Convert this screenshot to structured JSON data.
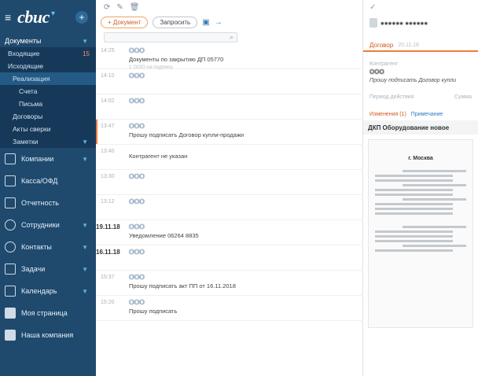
{
  "app": {
    "logo": "cbuc"
  },
  "sidebar": {
    "docs_header": "Документы",
    "sub_items": [
      {
        "label": "Входящие",
        "count": "15",
        "level": 1
      },
      {
        "label": "Исходящие",
        "count": "",
        "level": 1
      },
      {
        "label": "Реализация",
        "count": "",
        "level": 2
      },
      {
        "label": "Счета",
        "count": "",
        "level": 3
      },
      {
        "label": "Письма",
        "count": "",
        "level": 3
      },
      {
        "label": "Договоры",
        "count": "",
        "level": 2
      },
      {
        "label": "Акты сверки",
        "count": "",
        "level": 2
      },
      {
        "label": "Заметки",
        "count": "",
        "level": 2
      }
    ],
    "nav": [
      {
        "label": "Компании",
        "icon": "buildings-icon"
      },
      {
        "label": "Касса/ОФД",
        "icon": "register-icon"
      },
      {
        "label": "Отчетность",
        "icon": "report-icon"
      },
      {
        "label": "Сотрудники",
        "icon": "people-icon"
      },
      {
        "label": "Контакты",
        "icon": "contacts-icon"
      },
      {
        "label": "Задачи",
        "icon": "tasks-icon"
      },
      {
        "label": "Календарь",
        "icon": "calendar-icon"
      },
      {
        "label": "Моя страница",
        "icon": "user-icon"
      },
      {
        "label": "Наша компания",
        "icon": "company-icon"
      }
    ]
  },
  "toolbar": {
    "btn_documents": "+ Документ",
    "btn_request": "Запросить",
    "search_placeholder": ""
  },
  "list": {
    "rows": [
      {
        "time": "14:25",
        "date": "",
        "title": "ООО",
        "desc": "Документы по закрытию ДП 05770",
        "meta": "1 ООО на подпись"
      },
      {
        "time": "14:10",
        "date": "",
        "title": "ООО",
        "desc": "",
        "meta": ""
      },
      {
        "time": "14:02",
        "date": "",
        "title": "ООО",
        "desc": "",
        "meta": ""
      },
      {
        "time": "13:47",
        "date": "",
        "title": "ООО",
        "desc": "Прошу подписать Договор купли-продажи",
        "meta": "",
        "accent": true
      },
      {
        "time": "13:40",
        "date": "",
        "title": "Контрагент не указан",
        "desc": "",
        "meta": ""
      },
      {
        "time": "13:30",
        "date": "",
        "title": "ООО",
        "desc": "",
        "meta": ""
      },
      {
        "time": "13:12",
        "date": "",
        "title": "ООО",
        "desc": "",
        "meta": ""
      },
      {
        "time": "",
        "date": "19.11.18",
        "title": "ООО",
        "desc": "Уведомление 06264 8835",
        "meta": ""
      },
      {
        "time": "",
        "date": "16.11.18",
        "title": "ООО",
        "desc": "",
        "meta": ""
      },
      {
        "time": "15:37",
        "date": "",
        "title": "ООО",
        "desc": "Прошу подписать акт ПП от 16.11.2018",
        "meta": ""
      },
      {
        "time": "15:20",
        "date": "",
        "title": "ООО",
        "desc": "Прошу подписать",
        "meta": ""
      }
    ]
  },
  "detail": {
    "tab_label": "Договор",
    "tab_date": "20.11.18",
    "counterparty_label": "Контрагент",
    "counterparty_value": "ООО",
    "note": "Прошу подписать Договор купли",
    "period_label": "Период действия",
    "sum_label": "Сумма",
    "links_changes": "Изменения (1)",
    "links_note": "Примечание",
    "doc_title": "ДКП Оборудование новое",
    "doc_city": "г. Москва"
  }
}
